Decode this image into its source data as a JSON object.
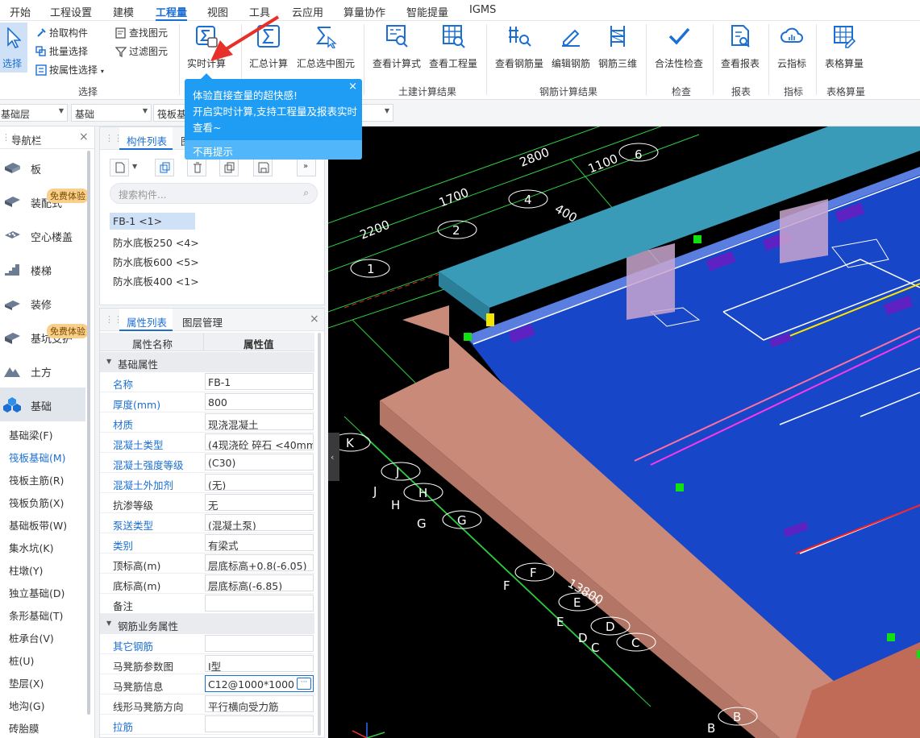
{
  "menu": {
    "items": [
      {
        "label": "开始"
      },
      {
        "label": "工程设置"
      },
      {
        "label": "建模"
      },
      {
        "label": "工程量"
      },
      {
        "label": "视图"
      },
      {
        "label": "工具"
      },
      {
        "label": "云应用"
      },
      {
        "label": "算量协作"
      },
      {
        "label": "智能提量"
      },
      {
        "label": "IGMS"
      }
    ],
    "active": "工程量"
  },
  "ribbon": {
    "select": {
      "select_label": "选择",
      "pick_label": "拾取构件",
      "batch_label": "批量选择",
      "by_attr_label": "按属性选择",
      "find_label": "查找图元",
      "filter_label": "过滤图元",
      "group_label": "选择"
    },
    "realtime_label": "实时计算",
    "summary_label": "汇总计算",
    "summary_selected_label": "汇总选中图元",
    "civil": {
      "formula_label": "查看计算式",
      "quantity_label": "查看工程量",
      "group_label": "土建计算结果"
    },
    "rebar": {
      "view_label": "查看钢筋量",
      "edit_label": "编辑钢筋",
      "3d_label": "钢筋三维",
      "group_label": "钢筋计算结果"
    },
    "check": {
      "label": "合法性检查",
      "group_label": "检查"
    },
    "report": {
      "label": "查看报表",
      "group_label": "报表"
    },
    "index": {
      "label": "云指标",
      "group_label": "指标"
    },
    "table": {
      "label": "表格算量",
      "group_label": "表格算量"
    }
  },
  "tip": {
    "line1": "体验直接查量的超快感!",
    "line2": "开启实时计算,支持工程量及报表实时",
    "line3": "查看~",
    "dismiss": "不再提示",
    "close": "×"
  },
  "floorbar": {
    "floor": "基础层",
    "category": "基础",
    "type": "筏板基"
  },
  "nav": {
    "title": "导航栏",
    "close": "×",
    "items": [
      {
        "label": "板"
      },
      {
        "label": "装配式"
      },
      {
        "label": "空心楼盖"
      },
      {
        "label": "楼梯"
      },
      {
        "label": "装修"
      },
      {
        "label": "基坑支护"
      },
      {
        "label": "土方"
      },
      {
        "label": "基础"
      }
    ],
    "badge": "免费体验",
    "subitems": [
      {
        "label": "基础梁(F)"
      },
      {
        "label": "筏板基础(M)"
      },
      {
        "label": "筏板主筋(R)"
      },
      {
        "label": "筏板负筋(X)"
      },
      {
        "label": "基础板带(W)"
      },
      {
        "label": "集水坑(K)"
      },
      {
        "label": "柱墩(Y)"
      },
      {
        "label": "独立基础(D)"
      },
      {
        "label": "条形基础(T)"
      },
      {
        "label": "桩承台(V)"
      },
      {
        "label": "桩(U)"
      },
      {
        "label": "垫层(X)"
      },
      {
        "label": "地沟(G)"
      },
      {
        "label": "砖胎膜"
      }
    ]
  },
  "components": {
    "tab_active": "构件列表",
    "tab_other": "图纸",
    "search_placeholder": "搜索构件...",
    "items": [
      {
        "label": "FB-1 <1>"
      },
      {
        "label": "防水底板250 <4>"
      },
      {
        "label": "防水底板600 <5>"
      },
      {
        "label": "防水底板400 <1>"
      }
    ]
  },
  "properties": {
    "tab_active": "属性列表",
    "tab_other": "图层管理",
    "close": "×",
    "col_name": "属性名称",
    "col_value": "属性值",
    "section1": "基础属性",
    "rows1": [
      {
        "name": "名称",
        "value": "FB-1",
        "blue": true
      },
      {
        "name": "厚度(mm)",
        "value": "800",
        "blue": true
      },
      {
        "name": "材质",
        "value": "现浇混凝土",
        "blue": true
      },
      {
        "name": "混凝土类型",
        "value": "(4现浇砼 碎石 <40mm)",
        "blue": true
      },
      {
        "name": "混凝土强度等级",
        "value": "(C30)",
        "blue": true
      },
      {
        "name": "混凝土外加剂",
        "value": "(无)",
        "blue": true
      },
      {
        "name": "抗渗等级",
        "value": "无",
        "blue": false
      },
      {
        "name": "泵送类型",
        "value": "(混凝土泵)",
        "blue": true
      },
      {
        "name": "类别",
        "value": "有梁式",
        "blue": true
      },
      {
        "name": "顶标高(m)",
        "value": "层底标高+0.8(-6.05)",
        "blue": false
      },
      {
        "name": "底标高(m)",
        "value": "层底标高(-6.85)",
        "blue": false
      },
      {
        "name": "备注",
        "value": "",
        "blue": false
      }
    ],
    "section2": "钢筋业务属性",
    "rows2": [
      {
        "name": "其它钢筋",
        "value": "",
        "blue": true
      },
      {
        "name": "马凳筋参数图",
        "value": "Ⅰ型",
        "blue": false
      },
      {
        "name": "马凳筋信息",
        "value": "C12@1000*1000",
        "blue": false
      },
      {
        "name": "线形马凳筋方向",
        "value": "平行横向受力筋",
        "blue": false
      },
      {
        "name": "拉筋",
        "value": "",
        "blue": true
      }
    ]
  },
  "viewport": {
    "dims": [
      "2200",
      "1700",
      "2800",
      "1100",
      "400",
      "13800"
    ],
    "axes": [
      "1",
      "2",
      "4",
      "6",
      "K",
      "J",
      "J",
      "H",
      "H",
      "G",
      "G",
      "F",
      "F",
      "E",
      "E",
      "D",
      "D",
      "C",
      "C",
      "B",
      "B"
    ],
    "colors": {
      "background": "#000000",
      "slab": "#1746c8",
      "beam_top": "#3a9bb8",
      "beam_side": "#c98a7a",
      "grid": "#2ecc40",
      "handle": "#11e011",
      "purple": "#5e22c2"
    }
  }
}
